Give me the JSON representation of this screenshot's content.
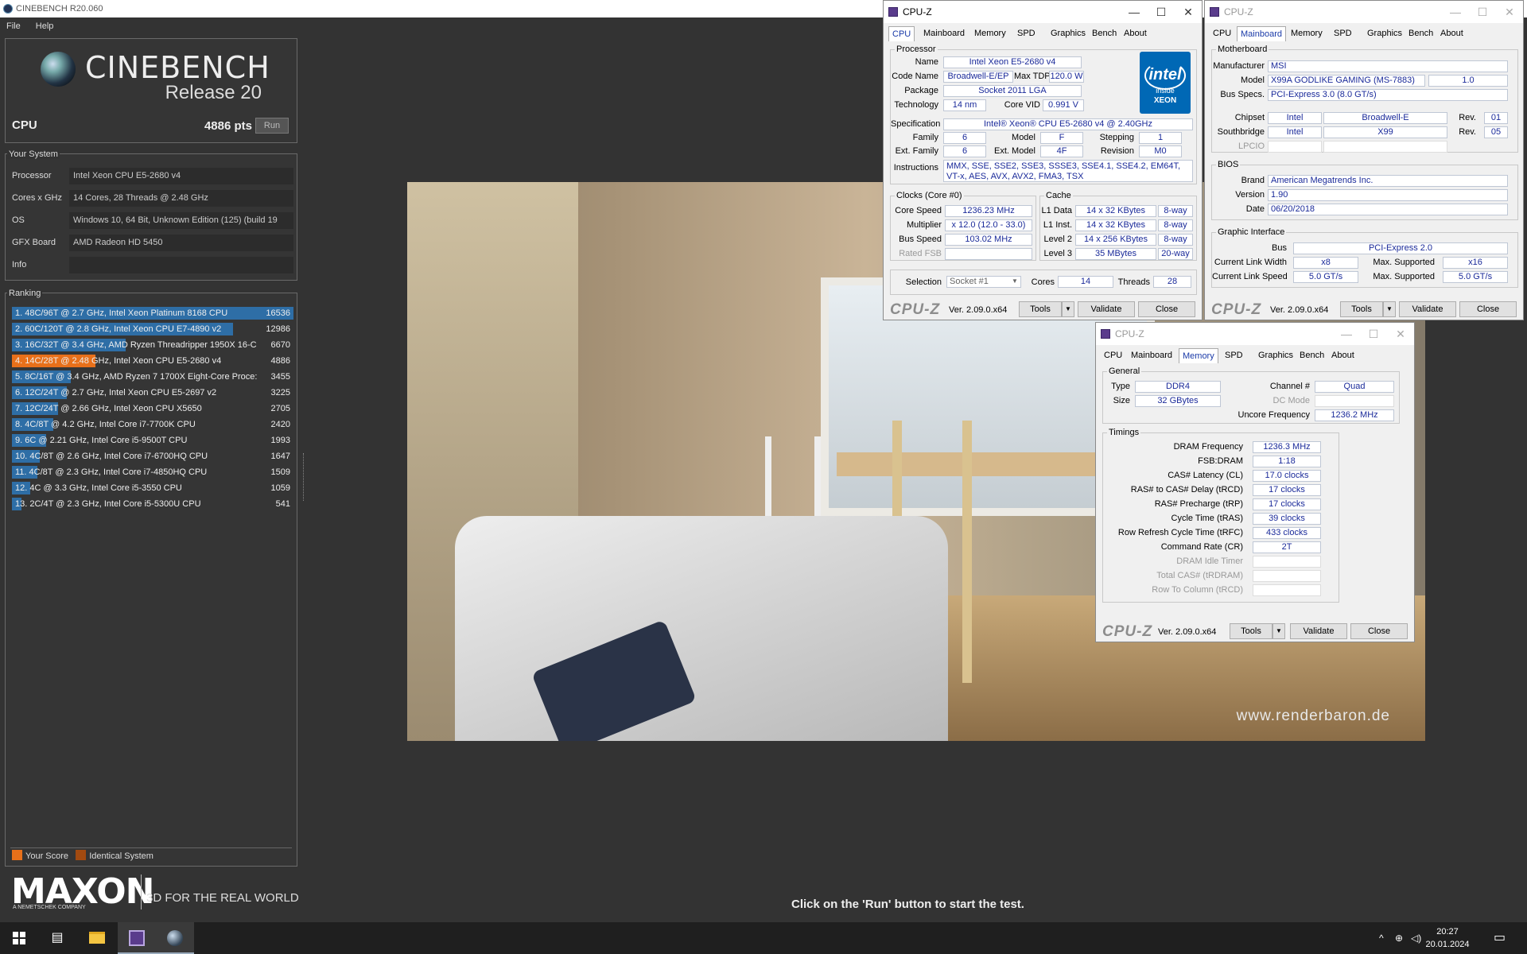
{
  "window": {
    "title": "CINEBENCH R20.060"
  },
  "menu": [
    "File",
    "Help"
  ],
  "cinebench": {
    "logo": "CINEBENCH",
    "release": "Release 20",
    "cpu_label": "CPU",
    "cpu_score": "4886 pts",
    "run_label": "Run"
  },
  "system": {
    "title": "Your System",
    "rows": [
      {
        "key": "Processor",
        "value": "Intel Xeon CPU E5-2680 v4"
      },
      {
        "key": "Cores x GHz",
        "value": "14 Cores, 28 Threads @ 2.48 GHz"
      },
      {
        "key": "OS",
        "value": "Windows 10, 64 Bit, Unknown Edition (125) (build 19"
      },
      {
        "key": "GFX Board",
        "value": "AMD Radeon HD 5450"
      },
      {
        "key": "Info",
        "value": ""
      }
    ]
  },
  "ranking": {
    "title": "Ranking",
    "max": 16536,
    "rows": [
      {
        "label": "1. 48C/96T @ 2.7 GHz, Intel Xeon Platinum 8168 CPU",
        "score": 16536,
        "highlight": false
      },
      {
        "label": "2. 60C/120T @ 2.8 GHz, Intel Xeon CPU E7-4890 v2",
        "score": 12986,
        "highlight": false
      },
      {
        "label": "3. 16C/32T @ 3.4 GHz, AMD Ryzen Threadripper 1950X 16-C",
        "score": 6670,
        "highlight": false
      },
      {
        "label": "4. 14C/28T @ 2.48 GHz, Intel Xeon CPU E5-2680 v4",
        "score": 4886,
        "highlight": true
      },
      {
        "label": "5. 8C/16T @ 3.4 GHz, AMD Ryzen 7 1700X Eight-Core Proce:",
        "score": 3455,
        "highlight": false
      },
      {
        "label": "6. 12C/24T @ 2.7 GHz, Intel Xeon CPU E5-2697 v2",
        "score": 3225,
        "highlight": false
      },
      {
        "label": "7. 12C/24T @ 2.66 GHz, Intel Xeon CPU X5650",
        "score": 2705,
        "highlight": false
      },
      {
        "label": "8. 4C/8T @ 4.2 GHz, Intel Core i7-7700K CPU",
        "score": 2420,
        "highlight": false
      },
      {
        "label": "9. 6C @ 2.21 GHz, Intel Core i5-9500T CPU",
        "score": 1993,
        "highlight": false
      },
      {
        "label": "10. 4C/8T @ 2.6 GHz, Intel Core i7-6700HQ CPU",
        "score": 1647,
        "highlight": false
      },
      {
        "label": "11. 4C/8T @ 2.3 GHz, Intel Core i7-4850HQ CPU",
        "score": 1509,
        "highlight": false
      },
      {
        "label": "12. 4C @ 3.3 GHz, Intel Core i5-3550 CPU",
        "score": 1059,
        "highlight": false
      },
      {
        "label": "13. 2C/4T @ 2.3 GHz, Intel Core i5-5300U CPU",
        "score": 541,
        "highlight": false
      }
    ],
    "legend": {
      "your_score": "Your Score",
      "identical": "Identical System"
    }
  },
  "maxon": {
    "logo": "MAXON",
    "sub": "A NEMETSCHEK COMPANY",
    "tagline": "3D FOR THE REAL WORLD"
  },
  "status_message": "Click on the 'Run' button to start the test.",
  "render": {
    "watermark": "www.renderbaron.de"
  },
  "cpuz_cpu": {
    "title": "CPU-Z",
    "tabs": [
      "CPU",
      "Mainboard",
      "Memory",
      "SPD",
      "Graphics",
      "Bench",
      "About"
    ],
    "active_tab": "CPU",
    "processor_title": "Processor",
    "name_label": "Name",
    "name": "Intel Xeon E5-2680 v4",
    "codename_label": "Code Name",
    "codename": "Broadwell-E/EP",
    "maxtdp_label": "Max TDP",
    "maxtdp": "120.0 W",
    "package_label": "Package",
    "package": "Socket 2011 LGA",
    "technology_label": "Technology",
    "technology": "14 nm",
    "corevid_label": "Core VID",
    "corevid": "0.991 V",
    "spec_label": "Specification",
    "spec": "Intel® Xeon® CPU E5-2680 v4 @ 2.40GHz",
    "family_label": "Family",
    "family": "6",
    "model_label": "Model",
    "model": "F",
    "stepping_label": "Stepping",
    "stepping": "1",
    "extfamily_label": "Ext. Family",
    "extfamily": "6",
    "extmodel_label": "Ext. Model",
    "extmodel": "4F",
    "revision_label": "Revision",
    "revision": "M0",
    "instructions_label": "Instructions",
    "instructions": "MMX, SSE, SSE2, SSE3, SSSE3, SSE4.1, SSE4.2, EM64T, VT-x, AES, AVX, AVX2, FMA3, TSX",
    "intel": {
      "brand": "intel",
      "inside": "inside",
      "line": "XEON"
    },
    "clocks_title": "Clocks (Core #0)",
    "corespeed_label": "Core Speed",
    "corespeed": "1236.23 MHz",
    "multiplier_label": "Multiplier",
    "multiplier": "x 12.0 (12.0 - 33.0)",
    "busspeed_label": "Bus Speed",
    "busspeed": "103.02 MHz",
    "ratedfsb_label": "Rated FSB",
    "ratedfsb": "",
    "cache_title": "Cache",
    "l1d_label": "L1 Data",
    "l1d": "14 x 32 KBytes",
    "l1d_way": "8-way",
    "l1i_label": "L1 Inst.",
    "l1i": "14 x 32 KBytes",
    "l1i_way": "8-way",
    "l2_label": "Level 2",
    "l2": "14 x 256 KBytes",
    "l2_way": "8-way",
    "l3_label": "Level 3",
    "l3": "35 MBytes",
    "l3_way": "20-way",
    "selection_label": "Selection",
    "selection": "Socket #1",
    "cores_label": "Cores",
    "cores": "14",
    "threads_label": "Threads",
    "threads": "28",
    "brand": "CPU-Z",
    "version": "Ver. 2.09.0.x64",
    "tools": "Tools",
    "validate": "Validate",
    "close": "Close"
  },
  "cpuz_mb": {
    "title": "CPU-Z",
    "tabs": [
      "CPU",
      "Mainboard",
      "Memory",
      "SPD",
      "Graphics",
      "Bench",
      "About"
    ],
    "active_tab": "Mainboard",
    "mb_title": "Motherboard",
    "manufacturer_label": "Manufacturer",
    "manufacturer": "MSI",
    "model_label": "Model",
    "model": "X99A GODLIKE GAMING (MS-7883)",
    "model_rev": "1.0",
    "busspecs_label": "Bus Specs.",
    "busspecs": "PCI-Express 3.0 (8.0 GT/s)",
    "chipset_label": "Chipset",
    "chipset_vendor": "Intel",
    "chipset": "Broadwell-E",
    "chipset_rev_label": "Rev.",
    "chipset_rev": "01",
    "southbridge_label": "Southbridge",
    "sb_vendor": "Intel",
    "sb": "X99",
    "sb_rev_label": "Rev.",
    "sb_rev": "05",
    "lpcio_label": "LPCIO",
    "lpcio": "",
    "bios_title": "BIOS",
    "brand_label": "Brand",
    "brand_val": "American Megatrends Inc.",
    "version_label": "Version",
    "version_val": "1.90",
    "date_label": "Date",
    "date_val": "06/20/2018",
    "gi_title": "Graphic Interface",
    "bus_label": "Bus",
    "bus": "PCI-Express 2.0",
    "clw_label": "Current Link Width",
    "clw": "x8",
    "msw_label": "Max. Supported",
    "msw": "x16",
    "cls_label": "Current Link Speed",
    "cls": "5.0 GT/s",
    "mss_label": "Max. Supported",
    "mss": "5.0 GT/s",
    "brand": "CPU-Z",
    "version": "Ver. 2.09.0.x64",
    "tools": "Tools",
    "validate": "Validate",
    "close": "Close"
  },
  "cpuz_mem": {
    "title": "CPU-Z",
    "tabs": [
      "CPU",
      "Mainboard",
      "Memory",
      "SPD",
      "Graphics",
      "Bench",
      "About"
    ],
    "active_tab": "Memory",
    "general_title": "General",
    "type_label": "Type",
    "type": "DDR4",
    "size_label": "Size",
    "size": "32 GBytes",
    "channel_label": "Channel #",
    "channel": "Quad",
    "dcmode_label": "DC Mode",
    "dcmode": "",
    "uncore_label": "Uncore Frequency",
    "uncore": "1236.2 MHz",
    "timings_title": "Timings",
    "timings": [
      {
        "label": "DRAM Frequency",
        "value": "1236.3 MHz",
        "dim": false
      },
      {
        "label": "FSB:DRAM",
        "value": "1:18",
        "dim": false
      },
      {
        "label": "CAS# Latency (CL)",
        "value": "17.0 clocks",
        "dim": false
      },
      {
        "label": "RAS# to CAS# Delay (tRCD)",
        "value": "17 clocks",
        "dim": false
      },
      {
        "label": "RAS# Precharge (tRP)",
        "value": "17 clocks",
        "dim": false
      },
      {
        "label": "Cycle Time (tRAS)",
        "value": "39 clocks",
        "dim": false
      },
      {
        "label": "Row Refresh Cycle Time (tRFC)",
        "value": "433 clocks",
        "dim": false
      },
      {
        "label": "Command Rate (CR)",
        "value": "2T",
        "dim": false
      },
      {
        "label": "DRAM Idle Timer",
        "value": "",
        "dim": true
      },
      {
        "label": "Total CAS# (tRDRAM)",
        "value": "",
        "dim": true
      },
      {
        "label": "Row To Column (tRCD)",
        "value": "",
        "dim": true
      }
    ],
    "brand": "CPU-Z",
    "version": "Ver. 2.09.0.x64",
    "tools": "Tools",
    "validate": "Validate",
    "close": "Close"
  },
  "taskbar": {
    "clock_time": "20:27",
    "clock_date": "20.01.2024"
  },
  "colors": {
    "bar_blue": "#2e6ea6",
    "bar_orange": "#e8701a",
    "identical": "#a24a10"
  }
}
